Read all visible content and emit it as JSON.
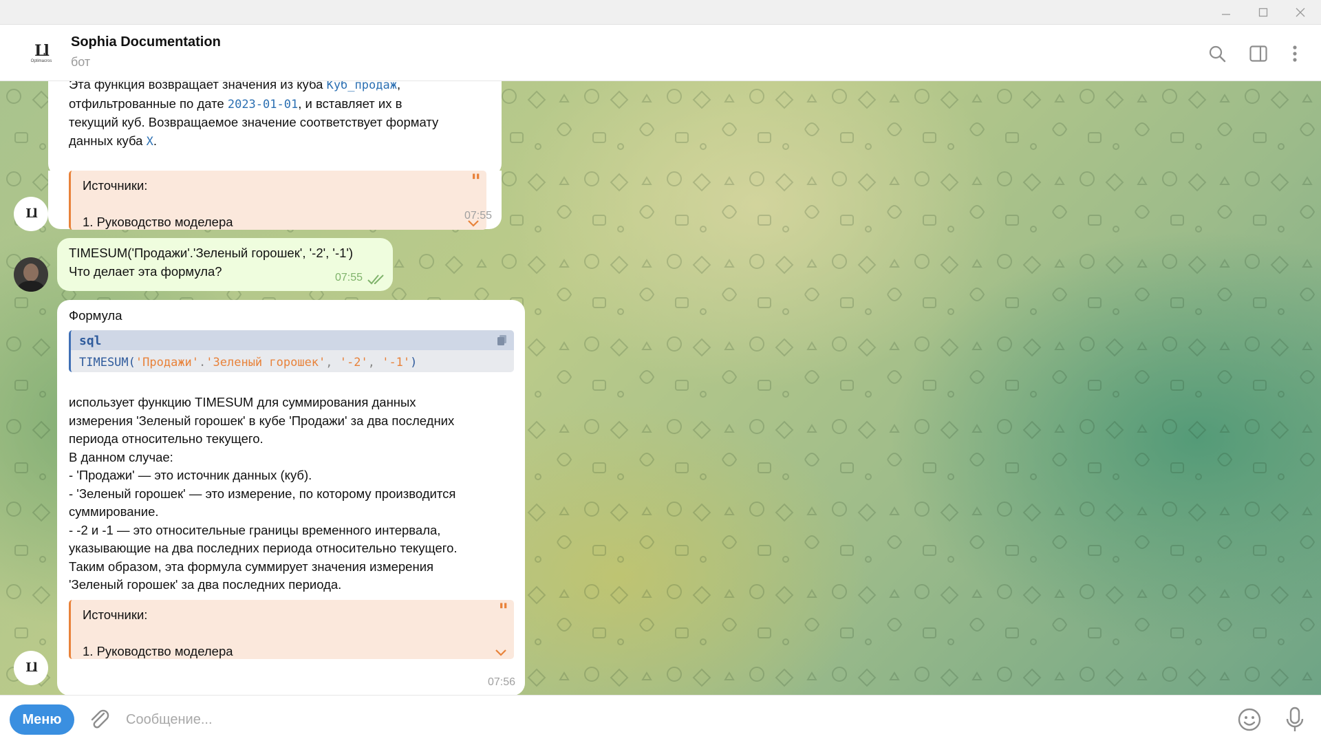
{
  "window": {
    "minimize_icon": "minimize-icon",
    "maximize_icon": "maximize-icon",
    "close_icon": "close-icon"
  },
  "header": {
    "title": "Sophia Documentation",
    "subtitle": "бот",
    "avatar_logo": "Optimacros"
  },
  "messages": {
    "bot1": {
      "text_line1_start": "Эта функция возвращает значения из куба ",
      "text_line1_code": "Куб_продаж",
      "text_line2_start": "отфильтрованные по дате ",
      "text_line2_code": "2023-01-01",
      "text_line2_end": ", и вставляет их в",
      "text_line3": "текущий куб. Возвращаемое значение соответствует формату",
      "text_line4_start": "данных куба ",
      "text_line4_code": "X",
      "text_line4_end": ".",
      "sources_title": "Источники:",
      "sources_item": "1. Руководство моделера",
      "time": "07:55"
    },
    "user1": {
      "line1": "TIMESUM('Продажи'.'Зеленый горошек', '-2', '-1')",
      "line2": "Что делает эта формула?",
      "time": "07:55"
    },
    "bot2": {
      "heading": "Формула",
      "code_lang": "sql",
      "code_fn": "TIMESUM",
      "code_paren_open": "(",
      "code_arg1": "'Продажи'",
      "code_dot": ".",
      "code_arg2": "'Зеленый горошек'",
      "code_comma1": ", ",
      "code_arg3": "'-2'",
      "code_comma2": ", ",
      "code_arg4": "'-1'",
      "code_paren_close": ")",
      "lines": [
        "использует функцию TIMESUM для суммирования данных",
        "измерения 'Зеленый горошек' в кубе 'Продажи' за два последних",
        "периода относительно текущего.",
        "В данном случае:",
        "- 'Продажи' — это источник данных (куб).",
        "- 'Зеленый горошек' — это измерение, по которому производится",
        "суммирование.",
        "- -2 и -1 — это относительные границы временного интервала,",
        "указывающие на два последних периода относительно текущего.",
        "Таким образом, эта формула суммирует значения измерения",
        "'Зеленый горошек' за два последних периода."
      ],
      "sources_title": "Источники:",
      "sources_item": "1. Руководство моделера",
      "time": "07:56"
    }
  },
  "composer": {
    "menu_label": "Меню",
    "placeholder": "Сообщение..."
  },
  "colors": {
    "accent": "#3a8fe0",
    "quote": "#e8823a",
    "outgoing": "#effdde"
  }
}
